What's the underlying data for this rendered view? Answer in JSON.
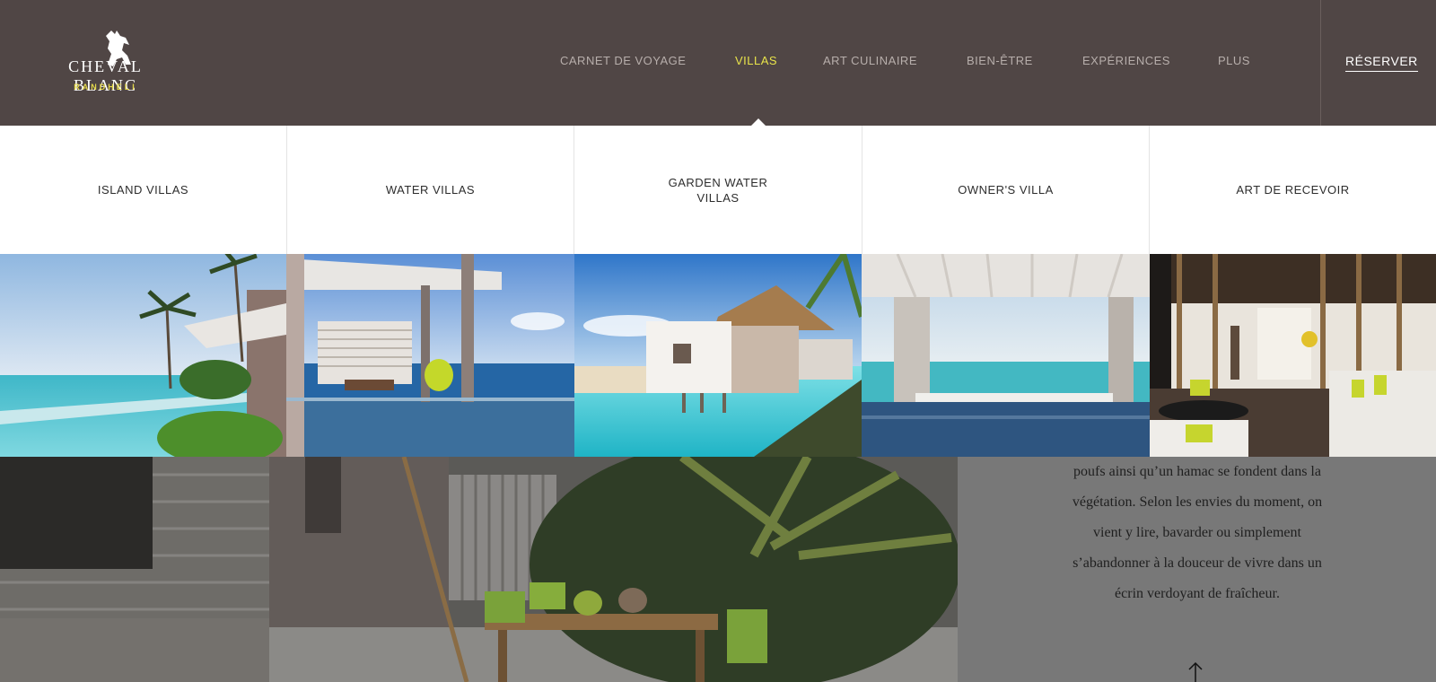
{
  "logo": {
    "brand": "CHEVAL BLANC",
    "subtitle": "RANDHELI",
    "icon": "horse-icon"
  },
  "nav": {
    "items": [
      {
        "label": "CARNET DE VOYAGE",
        "active": false
      },
      {
        "label": "VILLAS",
        "active": true
      },
      {
        "label": "ART CULINAIRE",
        "active": false
      },
      {
        "label": "BIEN-ÊTRE",
        "active": false
      },
      {
        "label": "EXPÉRIENCES",
        "active": false
      },
      {
        "label": "PLUS",
        "active": false
      }
    ],
    "reserve_label": "RÉSERVER"
  },
  "submenu": {
    "items": [
      {
        "label": "ISLAND VILLAS"
      },
      {
        "label": "WATER VILLAS"
      },
      {
        "label": "GARDEN WATER VILLAS"
      },
      {
        "label": "OWNER'S VILLA"
      },
      {
        "label": "ART DE RECEVOIR"
      }
    ]
  },
  "description": {
    "lines": [
      "poufs ainsi qu’un hamac se fondent dans la",
      "végétation. Selon les envies du moment, on",
      "vient y lire, bavarder ou simplement",
      "s’abandonner à la douceur de vivre dans un",
      "écrin verdoyant de fraîcheur."
    ]
  },
  "scroll_top_icon": "arrow-up-icon",
  "colors": {
    "header_bg": "#504645",
    "accent": "#e8e34a",
    "nav_text": "#b7aeab",
    "panel_bg": "#787878"
  }
}
